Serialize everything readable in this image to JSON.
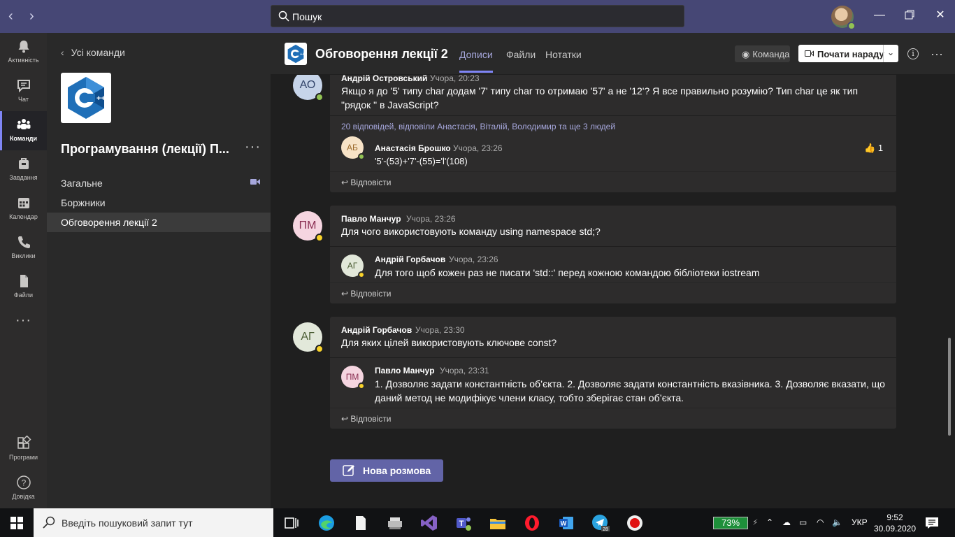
{
  "titlebar": {
    "search_placeholder": "Пошук"
  },
  "rail": [
    {
      "label": "Активність",
      "icon": "bell-icon"
    },
    {
      "label": "Чат",
      "icon": "chat-icon"
    },
    {
      "label": "Команди",
      "icon": "teams-icon"
    },
    {
      "label": "Завдання",
      "icon": "assignments-icon"
    },
    {
      "label": "Календар",
      "icon": "calendar-icon"
    },
    {
      "label": "Виклики",
      "icon": "phone-icon"
    },
    {
      "label": "Файли",
      "icon": "file-icon"
    },
    {
      "label": "Програми",
      "icon": "apps-icon"
    },
    {
      "label": "Довідка",
      "icon": "help-icon"
    }
  ],
  "left": {
    "back_label": "Усі команди",
    "team_name": "Програмування (лекції) П...",
    "channels": [
      "Загальне",
      "Боржники",
      "Обговорення лекції 2"
    ]
  },
  "header": {
    "channel_title": "Обговорення лекції 2",
    "tabs": [
      "Дописи",
      "Файли",
      "Нотатки"
    ],
    "team_label": "Команда",
    "meet_label": "Почати нараду"
  },
  "posts": [
    {
      "initials": "АО",
      "author": "Андрій Островський",
      "time": "Учора, 20:23",
      "text1": "Якщо я до '5' типу char додам '7' типу char то отримаю '57' а не '12'? Я все правильно розумію? Тип char це як тип",
      "text2": "\"рядок \" в JavaScript?",
      "replies": "20 відповідей, відповіли Анастасія, Віталій, Володимир та ще 3 людей",
      "reply": {
        "initials": "АБ",
        "author": "Анастасія Брошко",
        "time": "Учора, 23:26",
        "text": "'5'-(53)+'7'-(55)='l'(108)",
        "likes": "1"
      },
      "reply_label": "Відповісти"
    },
    {
      "initials": "ПМ",
      "author": "Павло Манчур",
      "time": "Учора, 23:26",
      "text": "Для чого використовують команду  using namespace std;?",
      "reply": {
        "initials": "АГ",
        "author": "Андрій Горбачов",
        "time": "Учора, 23:26",
        "text": "Для того щоб кожен раз не писати 'std::' перед кожною командою бібліотеки iostream"
      },
      "reply_label": "Відповісти"
    },
    {
      "initials": "АГ",
      "author": "Андрій Горбачов",
      "time": "Учора, 23:30",
      "text": "Для яких цілей використовують ключове const?",
      "reply": {
        "initials": "ПМ",
        "author": "Павло Манчур",
        "time": "Учора, 23:31",
        "text1": "1. Дозволяє задати константність об’єкта. 2. Дозволяє задати константність вказівника. 3. Дозволяє вказати, що",
        "text2": "даний метод не модифікує члени класу, тобто зберігає стан об’єкта."
      },
      "reply_label": "Відповісти"
    }
  ],
  "new_conversation": "Нова розмова",
  "taskbar": {
    "search_placeholder": "Введіть пошуковий запит тут",
    "battery": "73%",
    "lang": "УКР",
    "time": "9:52",
    "date": "30.09.2020",
    "telegram_badge": "28"
  }
}
